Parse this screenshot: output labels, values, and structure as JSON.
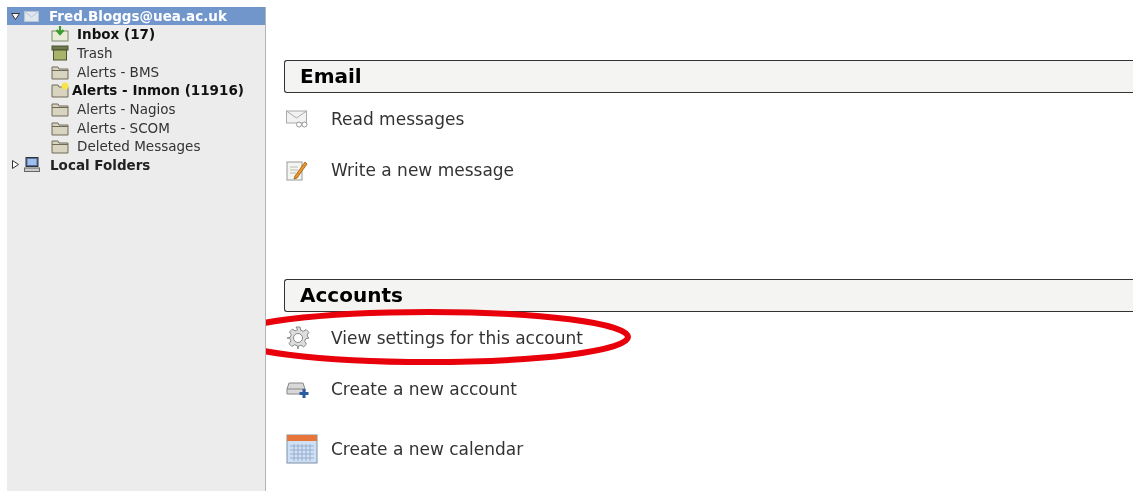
{
  "sidebar": {
    "accounts": [
      {
        "label": "Fred.Bloggs@uea.ac.uk",
        "kind": "mail",
        "expanded": true,
        "selected": true,
        "children": [
          {
            "label": "Inbox (17)",
            "kind": "inbox",
            "unread": true,
            "selected": false
          },
          {
            "label": "Trash",
            "kind": "trash",
            "unread": false,
            "selected": false
          },
          {
            "label": "Alerts - BMS",
            "kind": "folder",
            "unread": false,
            "selected": false
          },
          {
            "label": "Alerts - Inmon (11916)",
            "kind": "new-folder",
            "unread": true,
            "selected": false
          },
          {
            "label": "Alerts - Nagios",
            "kind": "folder",
            "unread": false,
            "selected": false
          },
          {
            "label": "Alerts - SCOM",
            "kind": "folder",
            "unread": false,
            "selected": false
          },
          {
            "label": "Deleted Messages",
            "kind": "folder",
            "unread": false,
            "selected": false
          }
        ]
      },
      {
        "label": "Local Folders",
        "kind": "computer",
        "expanded": false,
        "selected": false
      }
    ]
  },
  "sections": [
    {
      "title": "Email",
      "items": [
        {
          "label": "Read messages",
          "kind": "read",
          "circled": false
        },
        {
          "label": "Write a new message",
          "kind": "write",
          "circled": false
        }
      ]
    },
    {
      "title": "Accounts",
      "items": [
        {
          "label": "View settings for this account",
          "kind": "settings",
          "circled": true
        },
        {
          "label": "Create a new account",
          "kind": "new-account",
          "circled": false
        },
        {
          "label": "Create a new calendar",
          "kind": "calendar",
          "circled": false
        }
      ]
    }
  ]
}
